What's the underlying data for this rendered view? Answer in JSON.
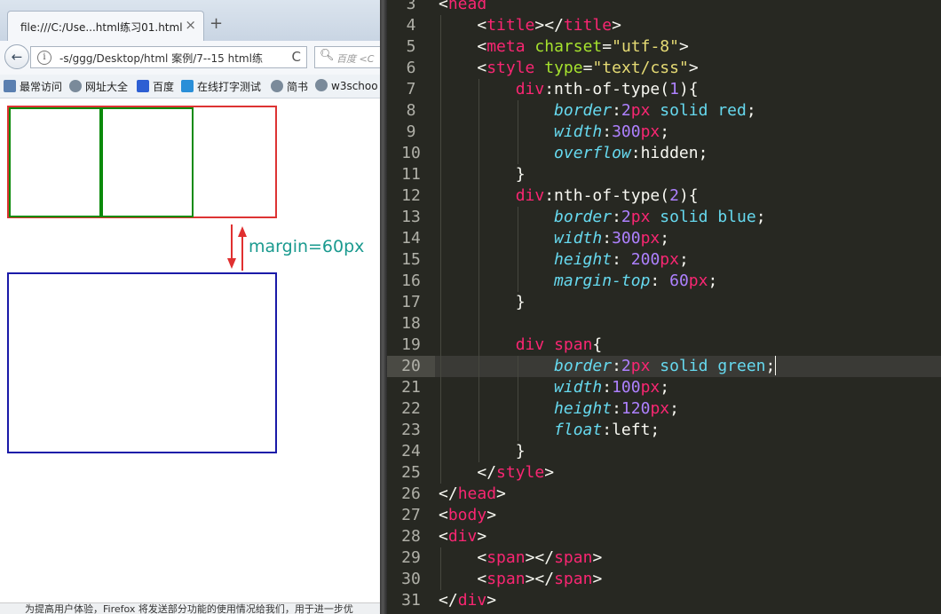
{
  "browser": {
    "tab_title": "file:///C:/Use...html练习01.html",
    "tab_close": "×",
    "new_tab": "+",
    "back_icon": "←",
    "url": "-s/ggg/Desktop/html 案例/7--15 html练",
    "reload_icon": "C",
    "search_placeholder": "百度 <C",
    "bookmarks": [
      "最常访问",
      "网址大全",
      "百度",
      "在线打字测试",
      "简书",
      "w3schoo"
    ],
    "annotation": "margin=60px",
    "status": "为提高用户体验，Firefox 将发送部分功能的使用情况给我们，用于进一步优"
  },
  "colors": {
    "div1_border": "#dd3333",
    "div2_border": "#1a1aa8",
    "span_border": "#0a8a0a",
    "annotation": "#1a9a8f",
    "editor_bg": "#272822"
  },
  "editor": {
    "current_line": 20,
    "lines": [
      {
        "n": 3,
        "indent": 0,
        "tokens": [
          [
            "pu",
            "<"
          ],
          [
            "tg",
            "head"
          ]
        ]
      },
      {
        "n": 4,
        "indent": 1,
        "tokens": [
          [
            "pu",
            "<"
          ],
          [
            "tg",
            "title"
          ],
          [
            "pu",
            "></"
          ],
          [
            "tg",
            "title"
          ],
          [
            "pu",
            ">"
          ]
        ]
      },
      {
        "n": 5,
        "indent": 1,
        "tokens": [
          [
            "pu",
            "<"
          ],
          [
            "tg",
            "meta"
          ],
          [
            "pu",
            " "
          ],
          [
            "attr",
            "charset"
          ],
          [
            "pu",
            "="
          ],
          [
            "str",
            "\"utf-8\""
          ],
          [
            "pu",
            ">"
          ]
        ]
      },
      {
        "n": 6,
        "indent": 1,
        "tokens": [
          [
            "pu",
            "<"
          ],
          [
            "tg",
            "style"
          ],
          [
            "pu",
            " "
          ],
          [
            "attr",
            "type"
          ],
          [
            "pu",
            "="
          ],
          [
            "str",
            "\"text/css\""
          ],
          [
            "pu",
            ">"
          ]
        ]
      },
      {
        "n": 7,
        "indent": 2,
        "tokens": [
          [
            "sel",
            "div"
          ],
          [
            "pu",
            ":nth-of-type("
          ],
          [
            "num",
            "1"
          ],
          [
            "pu",
            "){"
          ]
        ]
      },
      {
        "n": 8,
        "indent": 3,
        "tokens": [
          [
            "prop",
            "border"
          ],
          [
            "pu",
            ":"
          ],
          [
            "num",
            "2"
          ],
          [
            "unit",
            "px"
          ],
          [
            "pu",
            " "
          ],
          [
            "kw",
            "solid"
          ],
          [
            "pu",
            " "
          ],
          [
            "kw",
            "red"
          ],
          [
            "pu",
            ";"
          ]
        ]
      },
      {
        "n": 9,
        "indent": 3,
        "tokens": [
          [
            "prop",
            "width"
          ],
          [
            "pu",
            ":"
          ],
          [
            "num",
            "300"
          ],
          [
            "unit",
            "px"
          ],
          [
            "pu",
            ";"
          ]
        ]
      },
      {
        "n": 10,
        "indent": 3,
        "tokens": [
          [
            "prop",
            "overflow"
          ],
          [
            "pu",
            ":hidden;"
          ]
        ]
      },
      {
        "n": 11,
        "indent": 2,
        "tokens": [
          [
            "pu",
            "}"
          ]
        ]
      },
      {
        "n": 12,
        "indent": 2,
        "tokens": [
          [
            "sel",
            "div"
          ],
          [
            "pu",
            ":nth-of-type("
          ],
          [
            "num",
            "2"
          ],
          [
            "pu",
            "){"
          ]
        ]
      },
      {
        "n": 13,
        "indent": 3,
        "tokens": [
          [
            "prop",
            "border"
          ],
          [
            "pu",
            ":"
          ],
          [
            "num",
            "2"
          ],
          [
            "unit",
            "px"
          ],
          [
            "pu",
            " "
          ],
          [
            "kw",
            "solid"
          ],
          [
            "pu",
            " "
          ],
          [
            "kw",
            "blue"
          ],
          [
            "pu",
            ";"
          ]
        ]
      },
      {
        "n": 14,
        "indent": 3,
        "tokens": [
          [
            "prop",
            "width"
          ],
          [
            "pu",
            ":"
          ],
          [
            "num",
            "300"
          ],
          [
            "unit",
            "px"
          ],
          [
            "pu",
            ";"
          ]
        ]
      },
      {
        "n": 15,
        "indent": 3,
        "tokens": [
          [
            "prop",
            "height"
          ],
          [
            "pu",
            ": "
          ],
          [
            "num",
            "200"
          ],
          [
            "unit",
            "px"
          ],
          [
            "pu",
            ";"
          ]
        ]
      },
      {
        "n": 16,
        "indent": 3,
        "tokens": [
          [
            "prop",
            "margin-top"
          ],
          [
            "pu",
            ": "
          ],
          [
            "num",
            "60"
          ],
          [
            "unit",
            "px"
          ],
          [
            "pu",
            ";"
          ]
        ]
      },
      {
        "n": 17,
        "indent": 2,
        "tokens": [
          [
            "pu",
            "}"
          ]
        ]
      },
      {
        "n": 18,
        "indent": 2,
        "tokens": []
      },
      {
        "n": 19,
        "indent": 2,
        "tokens": [
          [
            "sel",
            "div"
          ],
          [
            "pu",
            " "
          ],
          [
            "sel",
            "span"
          ],
          [
            "pu",
            "{"
          ]
        ]
      },
      {
        "n": 20,
        "indent": 3,
        "tokens": [
          [
            "prop",
            "border"
          ],
          [
            "pu",
            ":"
          ],
          [
            "num",
            "2"
          ],
          [
            "unit",
            "px"
          ],
          [
            "pu",
            " "
          ],
          [
            "kw",
            "solid"
          ],
          [
            "pu",
            " "
          ],
          [
            "kw",
            "green"
          ],
          [
            "pu",
            ";"
          ]
        ]
      },
      {
        "n": 21,
        "indent": 3,
        "tokens": [
          [
            "prop",
            "width"
          ],
          [
            "pu",
            ":"
          ],
          [
            "num",
            "100"
          ],
          [
            "unit",
            "px"
          ],
          [
            "pu",
            ";"
          ]
        ]
      },
      {
        "n": 22,
        "indent": 3,
        "tokens": [
          [
            "prop",
            "height"
          ],
          [
            "pu",
            ":"
          ],
          [
            "num",
            "120"
          ],
          [
            "unit",
            "px"
          ],
          [
            "pu",
            ";"
          ]
        ]
      },
      {
        "n": 23,
        "indent": 3,
        "tokens": [
          [
            "prop",
            "float"
          ],
          [
            "pu",
            ":left;"
          ]
        ]
      },
      {
        "n": 24,
        "indent": 2,
        "tokens": [
          [
            "pu",
            "}"
          ]
        ]
      },
      {
        "n": 25,
        "indent": 1,
        "tokens": [
          [
            "pu",
            "</"
          ],
          [
            "tg",
            "style"
          ],
          [
            "pu",
            ">"
          ]
        ]
      },
      {
        "n": 26,
        "indent": 0,
        "tokens": [
          [
            "pu",
            "</"
          ],
          [
            "tg",
            "head"
          ],
          [
            "pu",
            ">"
          ]
        ]
      },
      {
        "n": 27,
        "indent": 0,
        "tokens": [
          [
            "pu",
            "<"
          ],
          [
            "tg",
            "body"
          ],
          [
            "pu",
            ">"
          ]
        ]
      },
      {
        "n": 28,
        "indent": 0,
        "tokens": [
          [
            "pu",
            "<"
          ],
          [
            "tg",
            "div"
          ],
          [
            "pu",
            ">"
          ]
        ]
      },
      {
        "n": 29,
        "indent": 1,
        "tokens": [
          [
            "pu",
            "<"
          ],
          [
            "tg",
            "span"
          ],
          [
            "pu",
            "></"
          ],
          [
            "tg",
            "span"
          ],
          [
            "pu",
            ">"
          ]
        ]
      },
      {
        "n": 30,
        "indent": 1,
        "tokens": [
          [
            "pu",
            "<"
          ],
          [
            "tg",
            "span"
          ],
          [
            "pu",
            "></"
          ],
          [
            "tg",
            "span"
          ],
          [
            "pu",
            ">"
          ]
        ]
      },
      {
        "n": 31,
        "indent": 0,
        "tokens": [
          [
            "pu",
            "</"
          ],
          [
            "tg",
            "div"
          ],
          [
            "pu",
            ">"
          ]
        ]
      }
    ]
  }
}
